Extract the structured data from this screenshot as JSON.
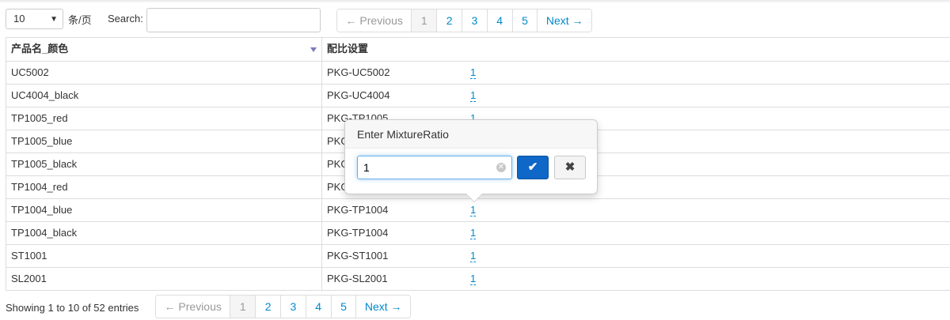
{
  "length_menu": {
    "value": "10",
    "suffix": "条/页"
  },
  "search": {
    "label": "Search:",
    "value": ""
  },
  "pagination": {
    "previous": "← Previous",
    "next": "Next →",
    "pages": [
      "1",
      "2",
      "3",
      "4",
      "5"
    ],
    "active_page": "1"
  },
  "table": {
    "headers": [
      "产品名_颜色",
      "配比设置"
    ],
    "rows": [
      {
        "name": "UC5002",
        "package": "PKG-UC5002",
        "ratio": "1"
      },
      {
        "name": "UC4004_black",
        "package": "PKG-UC4004",
        "ratio": "1"
      },
      {
        "name": "TP1005_red",
        "package": "PKG-TP1005",
        "ratio": "1"
      },
      {
        "name": "TP1005_blue",
        "package": "PKG",
        "ratio": ""
      },
      {
        "name": "TP1005_black",
        "package": "PKG",
        "ratio": ""
      },
      {
        "name": "TP1004_red",
        "package": "PKG",
        "ratio": ""
      },
      {
        "name": "TP1004_blue",
        "package": "PKG-TP1004",
        "ratio": "1"
      },
      {
        "name": "TP1004_black",
        "package": "PKG-TP1004",
        "ratio": "1"
      },
      {
        "name": "ST1001",
        "package": "PKG-ST1001",
        "ratio": "1"
      },
      {
        "name": "SL2001",
        "package": "PKG-SL2001",
        "ratio": "1"
      }
    ]
  },
  "popover": {
    "title": "Enter MixtureRatio",
    "input_value": "1"
  },
  "info": "Showing 1 to 10 of 52 entries",
  "colors": {
    "link": "#0088cc",
    "primary_button": "#0f67c7",
    "sort_icon": "#7b7bbd"
  }
}
